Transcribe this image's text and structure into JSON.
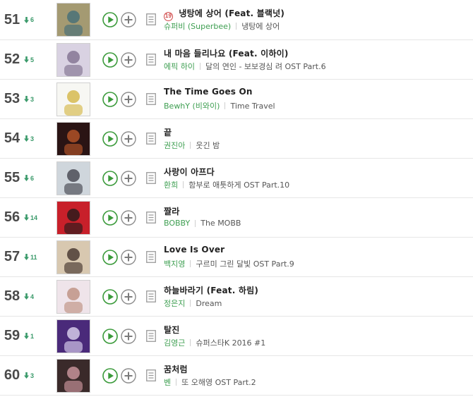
{
  "rows": [
    {
      "rank": "51",
      "change": "6",
      "adult": "19",
      "title": "냉탕에 상어 (Feat. 블랙넛)",
      "artist": "슈퍼비 (Superbee)",
      "album": "냉탕에 상어",
      "art": {
        "bg": "#a49a72",
        "fg": "#3e6b7a"
      }
    },
    {
      "rank": "52",
      "change": "5",
      "title": "내 마음 들리나요 (Feat. 이하이)",
      "artist": "에픽 하이",
      "album": "달의 연인 - 보보경심 려 OST Part.6",
      "art": {
        "bg": "#d9d2e2",
        "fg": "#7a6a8a"
      }
    },
    {
      "rank": "53",
      "change": "3",
      "title": "The Time Goes On",
      "artist": "BewhY (비와이)",
      "album": "Time Travel",
      "art": {
        "bg": "#f7f7f3",
        "fg": "#d2b23a"
      }
    },
    {
      "rank": "54",
      "change": "3",
      "title": "끝",
      "artist": "권진아",
      "album": "웃긴 밤",
      "art": {
        "bg": "#2a1414",
        "fg": "#c25a2a"
      }
    },
    {
      "rank": "55",
      "change": "6",
      "title": "사랑이 아프다",
      "artist": "환희",
      "album": "함부로 애틋하게 OST Part.10",
      "art": {
        "bg": "#cfd6dc",
        "fg": "#3a3a44"
      }
    },
    {
      "rank": "56",
      "change": "14",
      "title": "짤라",
      "artist": "BOBBY",
      "album": "The MOBB",
      "art": {
        "bg": "#c8202a",
        "fg": "#1a1a1a"
      }
    },
    {
      "rank": "57",
      "change": "11",
      "title": "Love Is Over",
      "artist": "백지영",
      "album": "구르미 그린 달빛 OST Part.9",
      "art": {
        "bg": "#d8c8b0",
        "fg": "#3a2a24"
      }
    },
    {
      "rank": "58",
      "change": "4",
      "title": "하늘바라기 (Feat. 하림)",
      "artist": "정은지",
      "album": "Dream",
      "art": {
        "bg": "#efe4ea",
        "fg": "#b98a78"
      }
    },
    {
      "rank": "59",
      "change": "1",
      "title": "탈진",
      "artist": "김영근",
      "album": "슈퍼스타K 2016 #1",
      "art": {
        "bg": "#4a2a7a",
        "fg": "#e8e0f8"
      }
    },
    {
      "rank": "60",
      "change": "3",
      "title": "꿈처럼",
      "artist": "벤",
      "album": "또 오해영 OST Part.2",
      "art": {
        "bg": "#3a2a2a",
        "fg": "#d8a0a8"
      }
    }
  ],
  "colors": {
    "artist": "#3f9f52",
    "down": "#3a9a6a",
    "play": "#3a9a3a"
  },
  "icons": {
    "play": "play-icon",
    "add": "add-icon",
    "lyric": "lyric-icon",
    "down": "down-arrow-icon"
  }
}
